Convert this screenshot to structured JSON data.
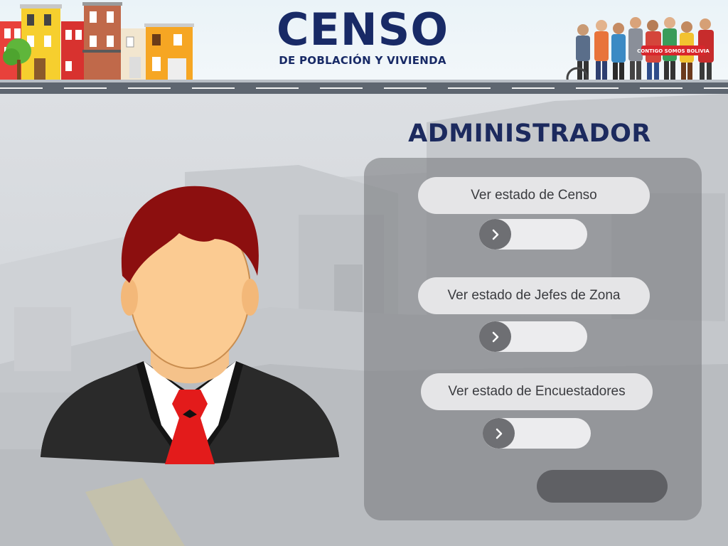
{
  "header": {
    "title": "CENSO",
    "subtitle": "DE POBLACIÓN Y VIVIENDA",
    "banner_text": "CONTIGO SOMOS BOLIVIA"
  },
  "role": {
    "title": "ADMINISTRADOR"
  },
  "menu": {
    "items": [
      {
        "label": "Ver estado de Censo",
        "icon": "chevron-right-icon"
      },
      {
        "label": "Ver estado de Jefes de Zona",
        "icon": "chevron-right-icon"
      },
      {
        "label": "Ver estado de Encuestadores",
        "icon": "chevron-right-icon"
      }
    ]
  },
  "colors": {
    "title_navy": "#1c2a5e",
    "panel": "#7a7c80",
    "pill": "#e5e5e7",
    "knob": "#6e6f73",
    "dark_button": "#5f6064",
    "tie": "#e31b1b",
    "hair": "#8c0f0f"
  }
}
